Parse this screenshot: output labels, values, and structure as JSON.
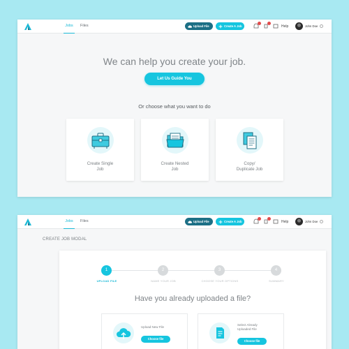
{
  "brand": {
    "accent": "#16c5df",
    "dark_button": "#1c6f85",
    "background": "#a8e9f2"
  },
  "nav": {
    "tabs": [
      {
        "label": "Jobs",
        "active": true
      },
      {
        "label": "Files",
        "active": false
      }
    ],
    "upload_file_label": "Upload File",
    "create_job_label": "Create A Job",
    "help_label": "Help",
    "user_name": "John Doe",
    "icons": [
      "cloud-upload-icon",
      "plus-icon",
      "notification-icon",
      "notification-icon",
      "help-icon",
      "settings-icon"
    ]
  },
  "screen1": {
    "hero_title": "We can help you create your job.",
    "guide_button": "Let Us Guide You",
    "choose_text": "Or choose what you want to do",
    "options": [
      {
        "line1": "Create Single",
        "line2": "Job",
        "icon": "briefcase-icon"
      },
      {
        "line1": "Create Nested",
        "line2": "Job",
        "icon": "folder-icon"
      },
      {
        "line1": "Copy/",
        "line2": "Duplicate Job",
        "icon": "copy-icon"
      }
    ]
  },
  "screen2": {
    "modal_title": "CREATE JOB MODAL",
    "steps": [
      {
        "number": "1",
        "label": "UPLOAD FILE",
        "active": true
      },
      {
        "number": "2",
        "label": "NAME YOUR JOB",
        "active": false
      },
      {
        "number": "3",
        "label": "CHOOSE YOUR OPTIONS",
        "active": false
      },
      {
        "number": "4",
        "label": "SUMMARY",
        "active": false
      }
    ],
    "question": "Have you already uploaded a file?",
    "choices": [
      {
        "line1": "Upload New File",
        "line2": "",
        "button": "Choose file",
        "icon": "cloud-upload-icon"
      },
      {
        "line1": "Select Already",
        "line2": "Uploaded File",
        "button": "Choose file",
        "icon": "document-icon"
      }
    ]
  }
}
